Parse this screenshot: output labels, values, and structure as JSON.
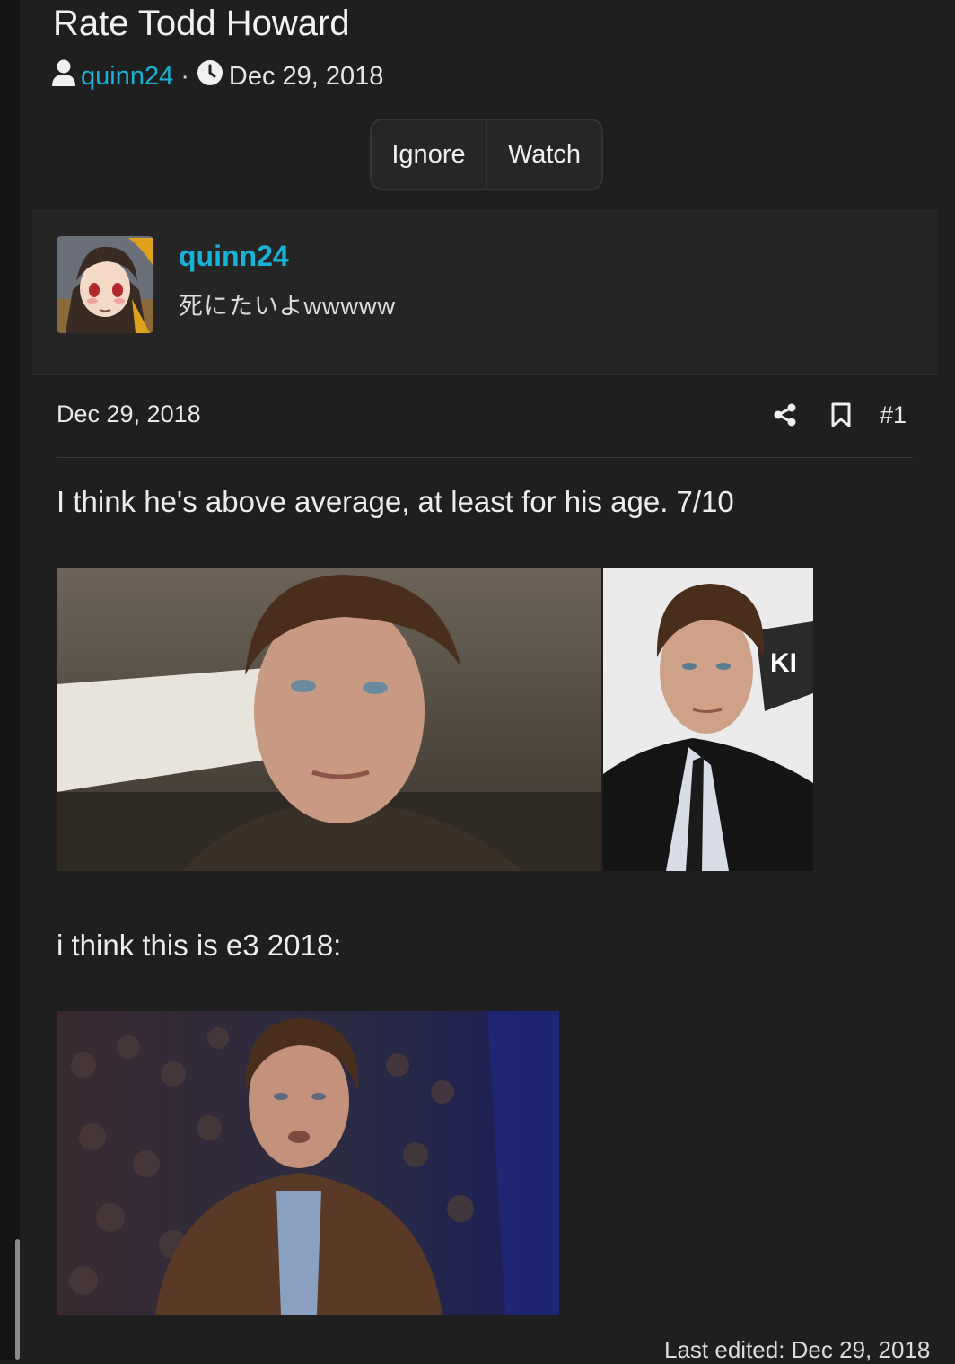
{
  "thread": {
    "title": "Rate Todd Howard",
    "author": "quinn24",
    "separator": "·",
    "date": "Dec 29, 2018"
  },
  "buttons": {
    "ignore": "Ignore",
    "watch": "Watch"
  },
  "user": {
    "name": "quinn24",
    "title": "死にたいよwwwww"
  },
  "post": {
    "date": "Dec 29, 2018",
    "number": "#1",
    "text1": "I think he's above average, at least for his age. 7/10",
    "text2": "i think this is e3 2018:",
    "last_edited": "Last edited: Dec 29, 2018"
  },
  "icons": {
    "author": "user-icon",
    "date": "clock-icon",
    "share": "share-icon",
    "bookmark": "bookmark-icon"
  },
  "colors": {
    "accent": "#17b3d6",
    "background": "#1f1f1f",
    "card": "#252525"
  }
}
